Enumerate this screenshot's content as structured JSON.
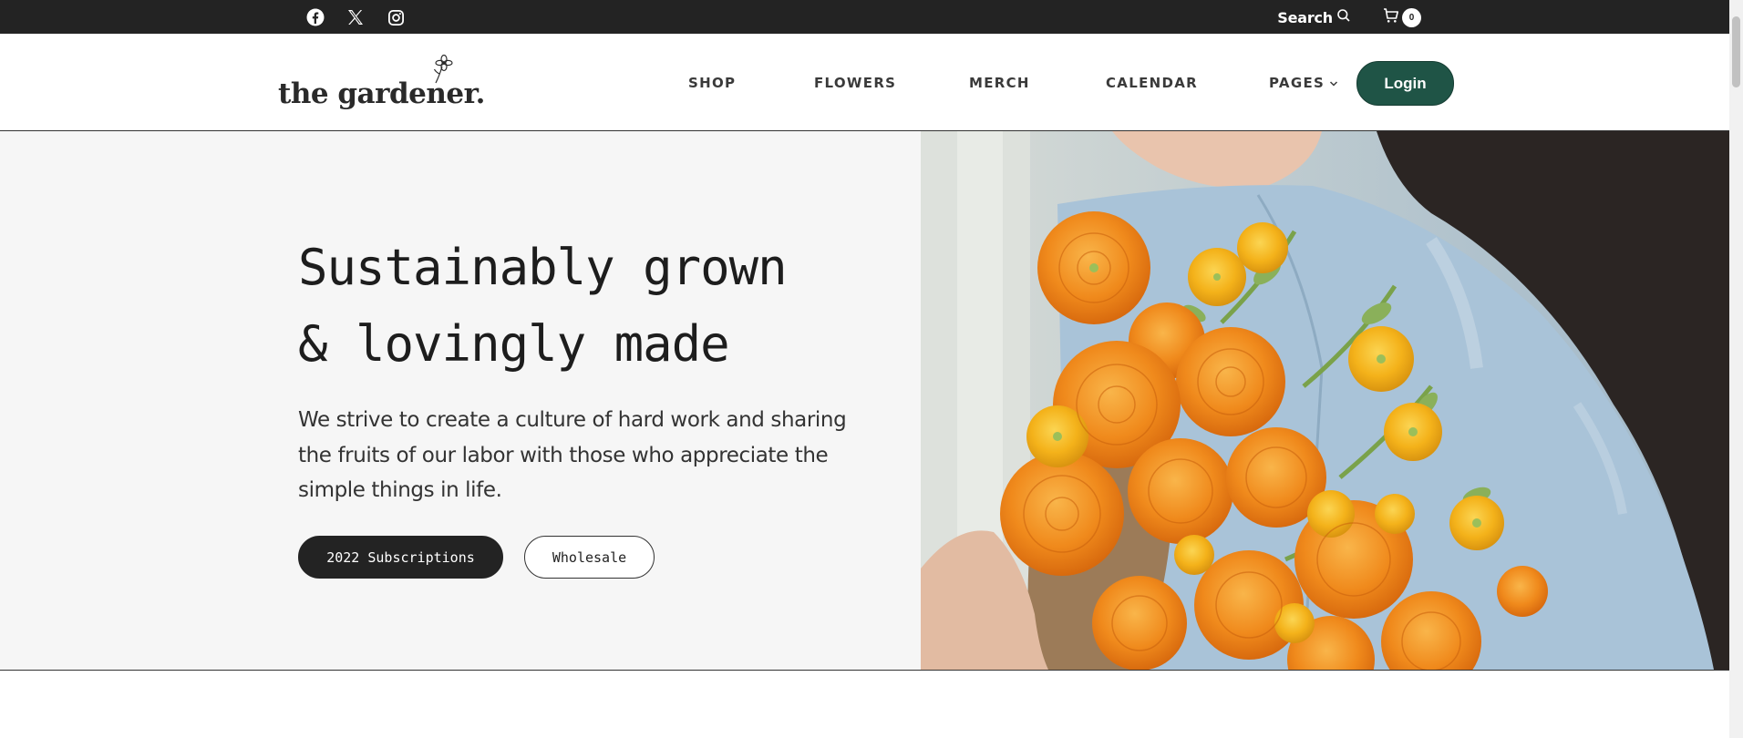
{
  "topbar": {
    "social": [
      {
        "icon": "facebook-icon"
      },
      {
        "icon": "x-twitter-icon"
      },
      {
        "icon": "instagram-icon"
      }
    ],
    "search_label": "Search",
    "cart_count": "0"
  },
  "header": {
    "logo_text": "the gardener.",
    "nav": {
      "shop": "SHOP",
      "flowers": "FLOWERS",
      "merch": "MERCH",
      "calendar": "CALENDAR",
      "pages": "PAGES"
    },
    "login_label": "Login"
  },
  "hero": {
    "title_line1": "Sustainably grown",
    "title_line2": "& lovingly made",
    "subtitle": "We strive to create a culture of hard work and sharing the fruits of our labor with those who appreciate the simple things in life.",
    "primary_button": "2022 Subscriptions",
    "secondary_button": "Wholesale",
    "image_subject": "woman in denim jacket holding bouquet of orange ranunculus"
  },
  "colors": {
    "topbar_bg": "#232323",
    "login_bg": "#1f5446",
    "hero_left_bg": "#f6f6f6",
    "flower_orange": "#f08a1c",
    "flower_yellow": "#f4b21a",
    "denim": "#a9c3d8"
  }
}
